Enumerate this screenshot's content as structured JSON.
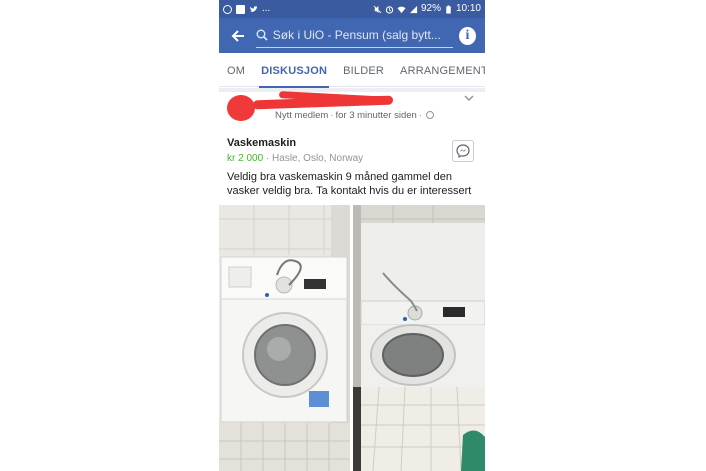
{
  "status_bar": {
    "battery": "92%",
    "time": "10:10",
    "overflow": "..."
  },
  "header": {
    "search_placeholder": "Søk i UiO - Pensum (salg bytt...",
    "info_label": "i"
  },
  "tabs": [
    {
      "label": "OM",
      "active": false
    },
    {
      "label": "DISKUSJON",
      "active": true
    },
    {
      "label": "BILDER",
      "active": false
    },
    {
      "label": "ARRANGEMENTER",
      "active": false
    }
  ],
  "post": {
    "author_role": "Nytt medlem",
    "timestamp": "for 3 minutter siden",
    "separator": "·",
    "listing": {
      "title": "Vaskemaskin",
      "price": "kr 2 000",
      "location": "Hasle, Oslo, Norway",
      "description": "Veldig bra vaskemaskin 9 måned gammel den vasker veldig bra. Ta kontakt hvis du er interessert"
    }
  },
  "colors": {
    "status_bar": "#3b5ba0",
    "header": "#4267b2",
    "price": "#42b72a",
    "active_tab": "#4267b2",
    "redaction": "#ee3636"
  },
  "icons": [
    "messenger-icon",
    "twitter-icon",
    "facebook-icon",
    "back-arrow-icon",
    "search-icon",
    "info-icon",
    "chevron-down-icon",
    "globe-icon",
    "messenger-chat-icon"
  ]
}
